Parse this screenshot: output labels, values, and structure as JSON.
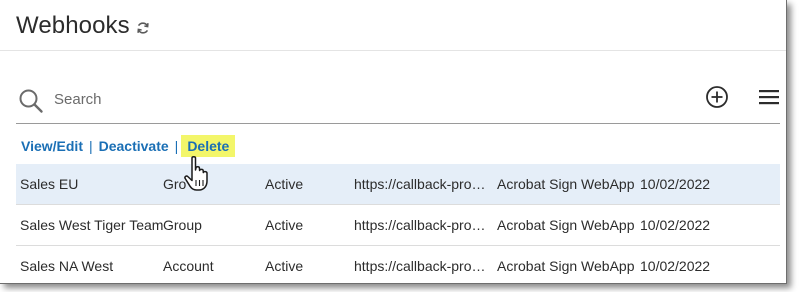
{
  "header": {
    "title": "Webhooks"
  },
  "search": {
    "placeholder": "Search",
    "value": ""
  },
  "actions": {
    "view_edit": "View/Edit",
    "separator": "|",
    "deactivate": "Deactivate",
    "delete": "Delete"
  },
  "toolbar_icons": [
    "refresh-icon",
    "search-icon",
    "add-circle-icon",
    "menu-icon"
  ],
  "colors": {
    "link": "#1a6fb5",
    "highlight": "#f3f66a",
    "selected_row": "#e5eef8"
  },
  "table": {
    "rows": [
      {
        "name": "Sales EU",
        "scope": "Gro",
        "status": "Active",
        "url": "https://callback-prod...",
        "application": "Acrobat Sign WebApp",
        "date": "10/02/2022",
        "selected": true
      },
      {
        "name": "Sales West Tiger Team",
        "scope": "Group",
        "status": "Active",
        "url": "https://callback-prod...",
        "application": "Acrobat Sign WebApp",
        "date": "10/02/2022",
        "selected": false
      },
      {
        "name": "Sales NA West",
        "scope": "Account",
        "status": "Active",
        "url": "https://callback-prod...",
        "application": "Acrobat Sign WebApp",
        "date": "10/02/2022",
        "selected": false
      }
    ]
  }
}
